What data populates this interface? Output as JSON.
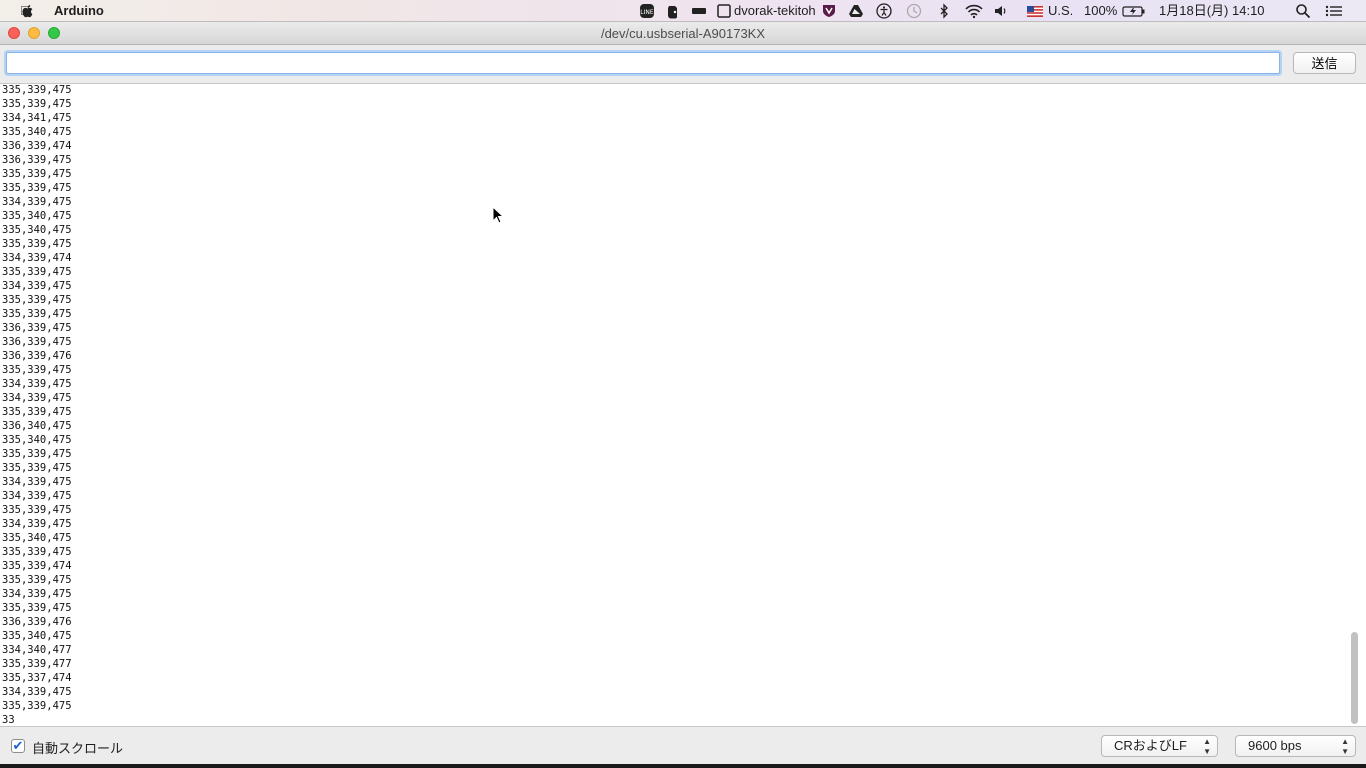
{
  "menubar": {
    "app_name": "Arduino",
    "apple_icon": "apple-icon",
    "status_icons": [
      "line-icon",
      "evernote-icon",
      "battery-strip-icon",
      "window-icon",
      "shield-icon",
      "drive-icon",
      "accessibility-icon",
      "time-machine-icon",
      "bluetooth-icon",
      "wifi-icon",
      "volume-icon",
      "us-flag-icon"
    ],
    "keyboard_layout": "dvorak-tekitoh",
    "input_source": "U.S.",
    "battery_percent": "100%",
    "date": "1月18日(月)",
    "time": "14:10"
  },
  "window": {
    "title": "/dev/cu.usbserial-A90173KX",
    "send_input_value": "",
    "send_button": "送信",
    "serial_lines": [
      "335,339,475",
      "335,339,475",
      "334,341,475",
      "335,340,475",
      "336,339,474",
      "336,339,475",
      "335,339,475",
      "335,339,475",
      "334,339,475",
      "335,340,475",
      "335,340,475",
      "335,339,475",
      "334,339,474",
      "335,339,475",
      "334,339,475",
      "335,339,475",
      "335,339,475",
      "336,339,475",
      "336,339,475",
      "336,339,476",
      "335,339,475",
      "334,339,475",
      "334,339,475",
      "335,339,475",
      "336,340,475",
      "335,340,475",
      "335,339,475",
      "335,339,475",
      "334,339,475",
      "334,339,475",
      "335,339,475",
      "334,339,475",
      "335,340,475",
      "335,339,475",
      "335,339,474",
      "335,339,475",
      "334,339,475",
      "335,339,475",
      "336,339,476",
      "335,340,475",
      "334,340,477",
      "335,339,477",
      "335,337,474",
      "334,339,475",
      "335,339,475",
      "33"
    ],
    "autoscroll_label": "自動スクロール",
    "autoscroll_checked": true,
    "line_ending": "CRおよびLF",
    "baud_rate": "9600 bps"
  },
  "colors": {
    "close": "#fc605b",
    "minimize": "#fdbc40",
    "maximize": "#34c84a",
    "focus_ring": "#8ab4e8"
  }
}
